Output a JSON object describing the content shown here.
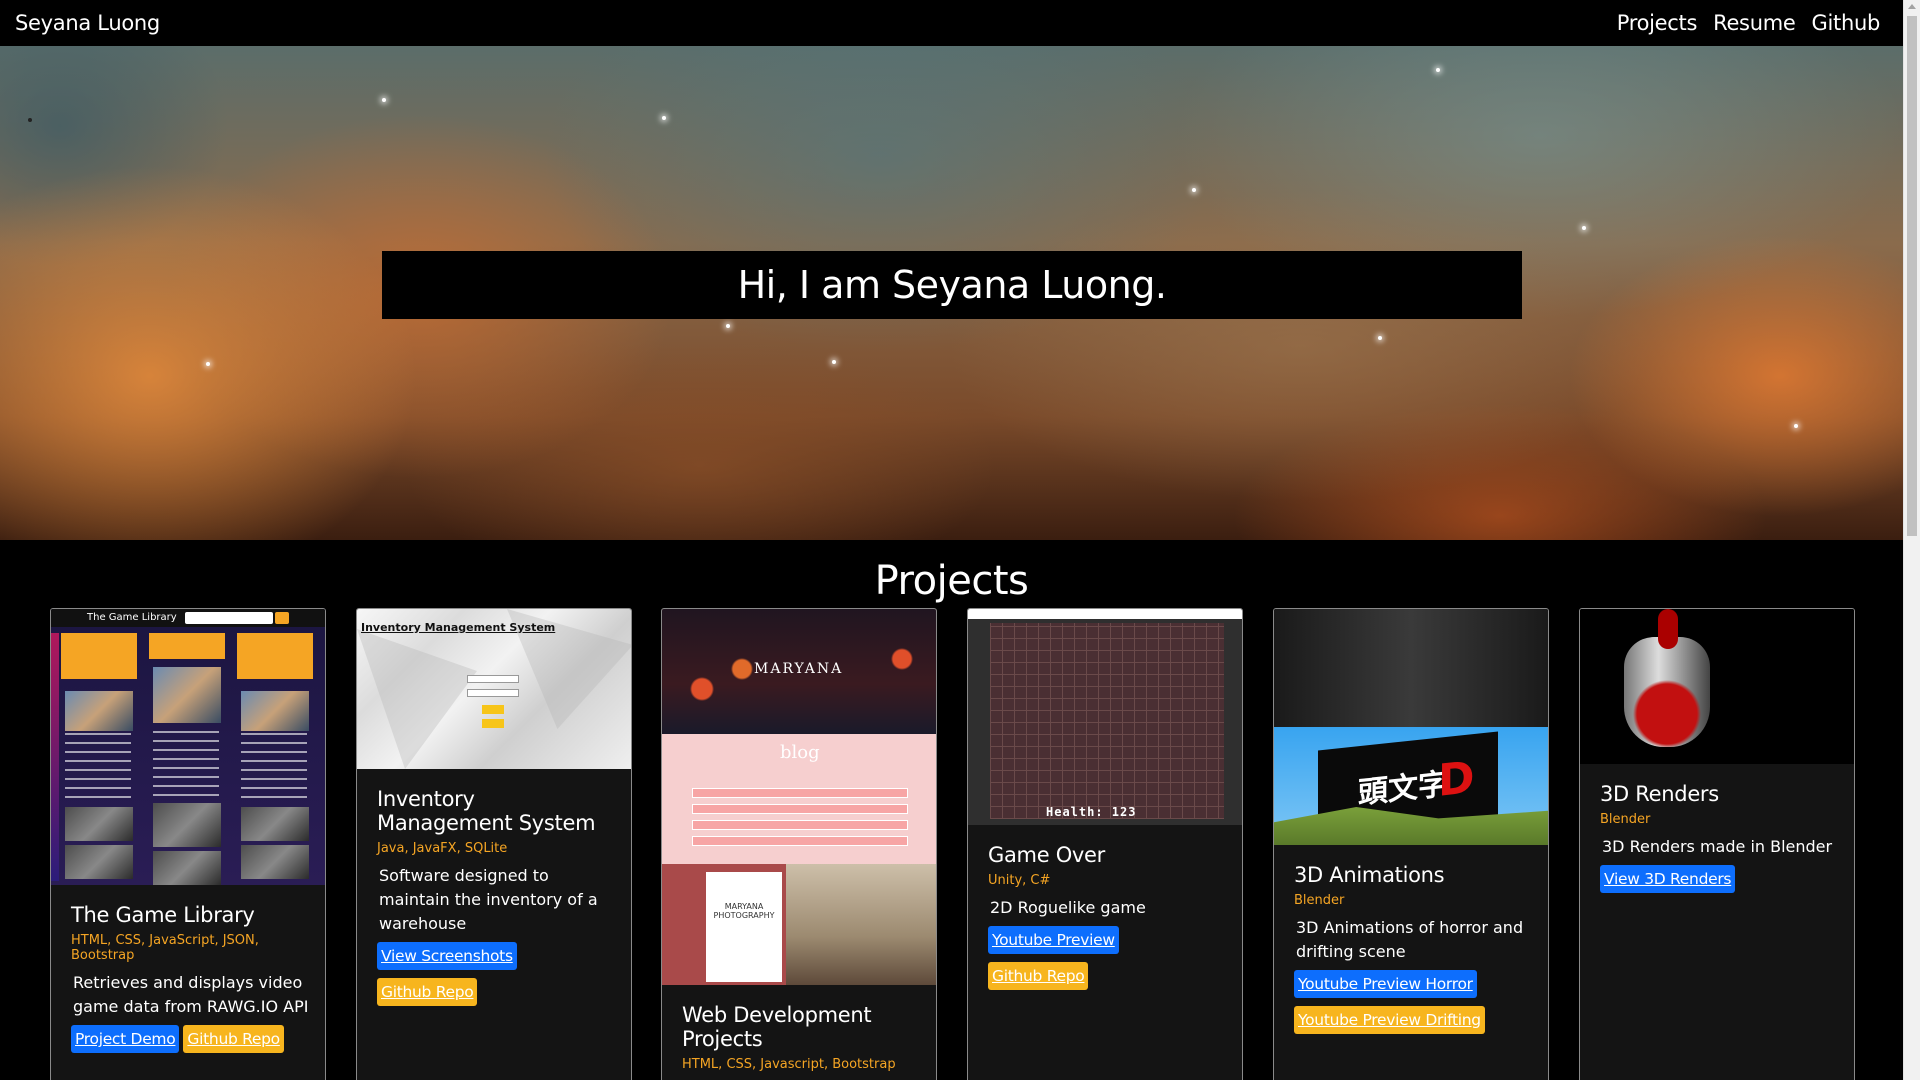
{
  "nav": {
    "brand": "Seyana Luong",
    "links": [
      "Projects",
      "Resume",
      "Github"
    ]
  },
  "hero": {
    "title": "Hi, I am Seyana Luong."
  },
  "projects": {
    "heading": "Projects",
    "cards": [
      {
        "title": "The Game Library",
        "tech": "HTML, CSS, JavaScript, JSON, Bootstrap",
        "desc": "Retrieves and displays video game data from RAWG.IO API",
        "buttons": [
          "Project Demo",
          "Github Repo"
        ],
        "thumb": {
          "bar_title": "The Game Library",
          "columns": [
            "Grand Theft Auto V",
            "Portal 2",
            "The Witcher 3: Wild Hunt"
          ]
        }
      },
      {
        "title": "Inventory Management System",
        "tech": "Java, JavaFX, SQLite",
        "desc": "Software designed to maintain the inventory of a warehouse",
        "buttons": [
          "View Screenshots",
          "Github Repo"
        ],
        "thumb": {
          "label": "Inventory Management System"
        }
      },
      {
        "title": "Web Development Projects",
        "tech": "HTML, CSS, Javascript, Bootstrap",
        "desc": "",
        "buttons": [],
        "thumb": {
          "hero_name": "MARYANA",
          "blog_label": "blog",
          "card_label": "MARYANA PHOTOGRAPHY"
        }
      },
      {
        "title": "Game Over",
        "tech": "Unity, C#",
        "desc": "2D Roguelike game",
        "buttons": [
          "Youtube Preview",
          "Github Repo"
        ],
        "thumb": {
          "health": "Health: 123"
        }
      },
      {
        "title": "3D Animations",
        "tech": "Blender",
        "desc": "3D Animations of horror and drifting scene",
        "buttons": [
          "Youtube Preview Horror",
          "Youtube Preview Drifting"
        ],
        "thumb": {
          "sign_text": "頭文字",
          "sign_letter": "D"
        }
      },
      {
        "title": "3D Renders",
        "tech": "Blender",
        "desc": "3D Renders made in Blender",
        "buttons": [
          "View 3D Renders"
        ]
      }
    ]
  },
  "colors": {
    "accent_blue": "#0d6efd",
    "accent_yellow": "#f7b51e",
    "tech_orange": "#f5a524",
    "card_bg": "#141414"
  }
}
